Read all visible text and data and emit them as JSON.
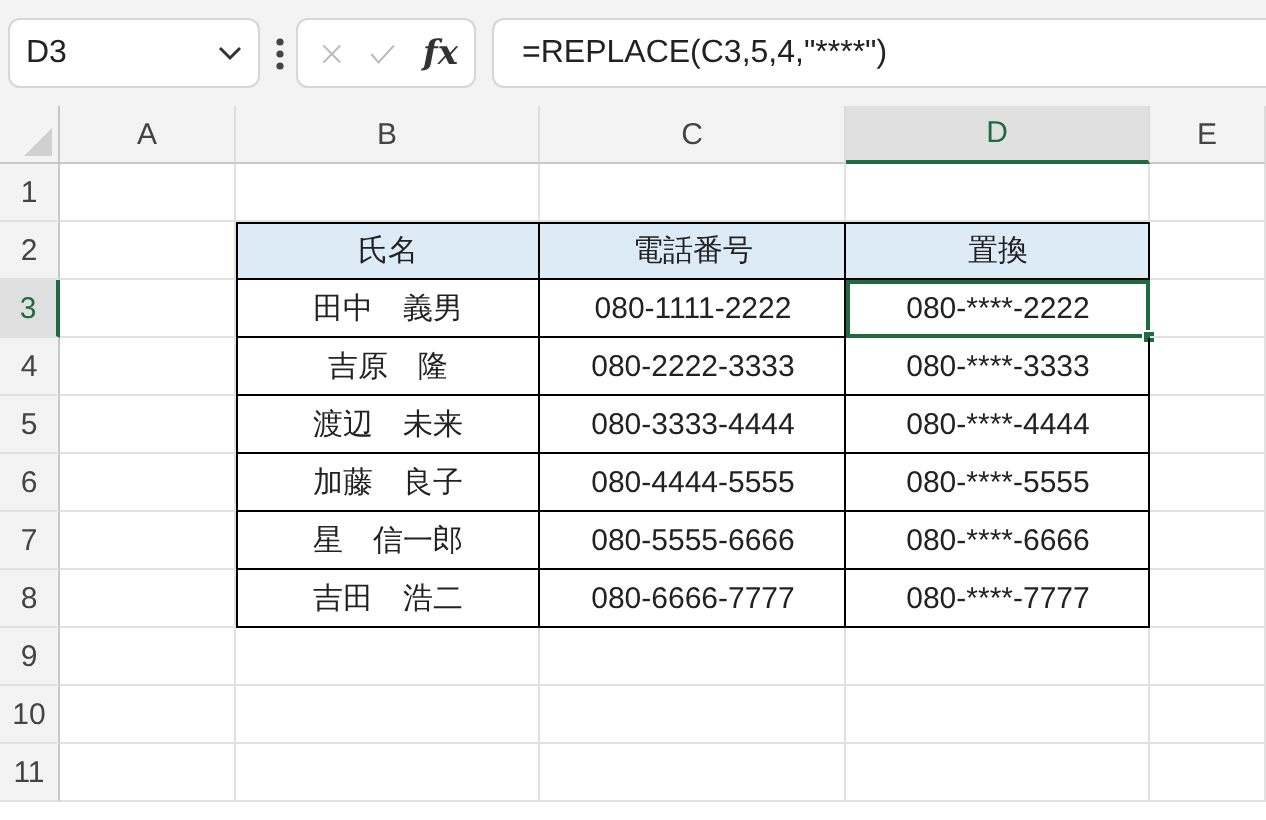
{
  "formula_bar": {
    "name_box": "D3",
    "function_label": "fx",
    "formula": "=REPLACE(C3,5,4,\"****\")"
  },
  "columns": [
    {
      "label": "A",
      "selected": false
    },
    {
      "label": "B",
      "selected": false
    },
    {
      "label": "C",
      "selected": false
    },
    {
      "label": "D",
      "selected": true
    },
    {
      "label": "E",
      "selected": false
    }
  ],
  "rows": [
    {
      "label": "1",
      "selected": false
    },
    {
      "label": "2",
      "selected": false
    },
    {
      "label": "3",
      "selected": true
    },
    {
      "label": "4",
      "selected": false
    },
    {
      "label": "5",
      "selected": false
    },
    {
      "label": "6",
      "selected": false
    },
    {
      "label": "7",
      "selected": false
    },
    {
      "label": "8",
      "selected": false
    },
    {
      "label": "9",
      "selected": false
    },
    {
      "label": "10",
      "selected": false
    },
    {
      "label": "11",
      "selected": false
    }
  ],
  "table": {
    "header": [
      "氏名",
      "電話番号",
      "置換"
    ],
    "rows": [
      {
        "cells": [
          {
            "text": "田中　義男",
            "selected": false
          },
          {
            "text": "080-1111-2222",
            "selected": false
          },
          {
            "text": "080-****-2222",
            "selected": true
          }
        ]
      },
      {
        "cells": [
          {
            "text": "吉原　隆",
            "selected": false
          },
          {
            "text": "080-2222-3333",
            "selected": false
          },
          {
            "text": "080-****-3333",
            "selected": false
          }
        ]
      },
      {
        "cells": [
          {
            "text": "渡辺　未来",
            "selected": false
          },
          {
            "text": "080-3333-4444",
            "selected": false
          },
          {
            "text": "080-****-4444",
            "selected": false
          }
        ]
      },
      {
        "cells": [
          {
            "text": "加藤　良子",
            "selected": false
          },
          {
            "text": "080-4444-5555",
            "selected": false
          },
          {
            "text": "080-****-5555",
            "selected": false
          }
        ]
      },
      {
        "cells": [
          {
            "text": "星　信一郎",
            "selected": false
          },
          {
            "text": "080-5555-6666",
            "selected": false
          },
          {
            "text": "080-****-6666",
            "selected": false
          }
        ]
      },
      {
        "cells": [
          {
            "text": "吉田　浩二",
            "selected": false
          },
          {
            "text": "080-6666-7777",
            "selected": false
          },
          {
            "text": "080-****-7777",
            "selected": false
          }
        ]
      }
    ]
  }
}
